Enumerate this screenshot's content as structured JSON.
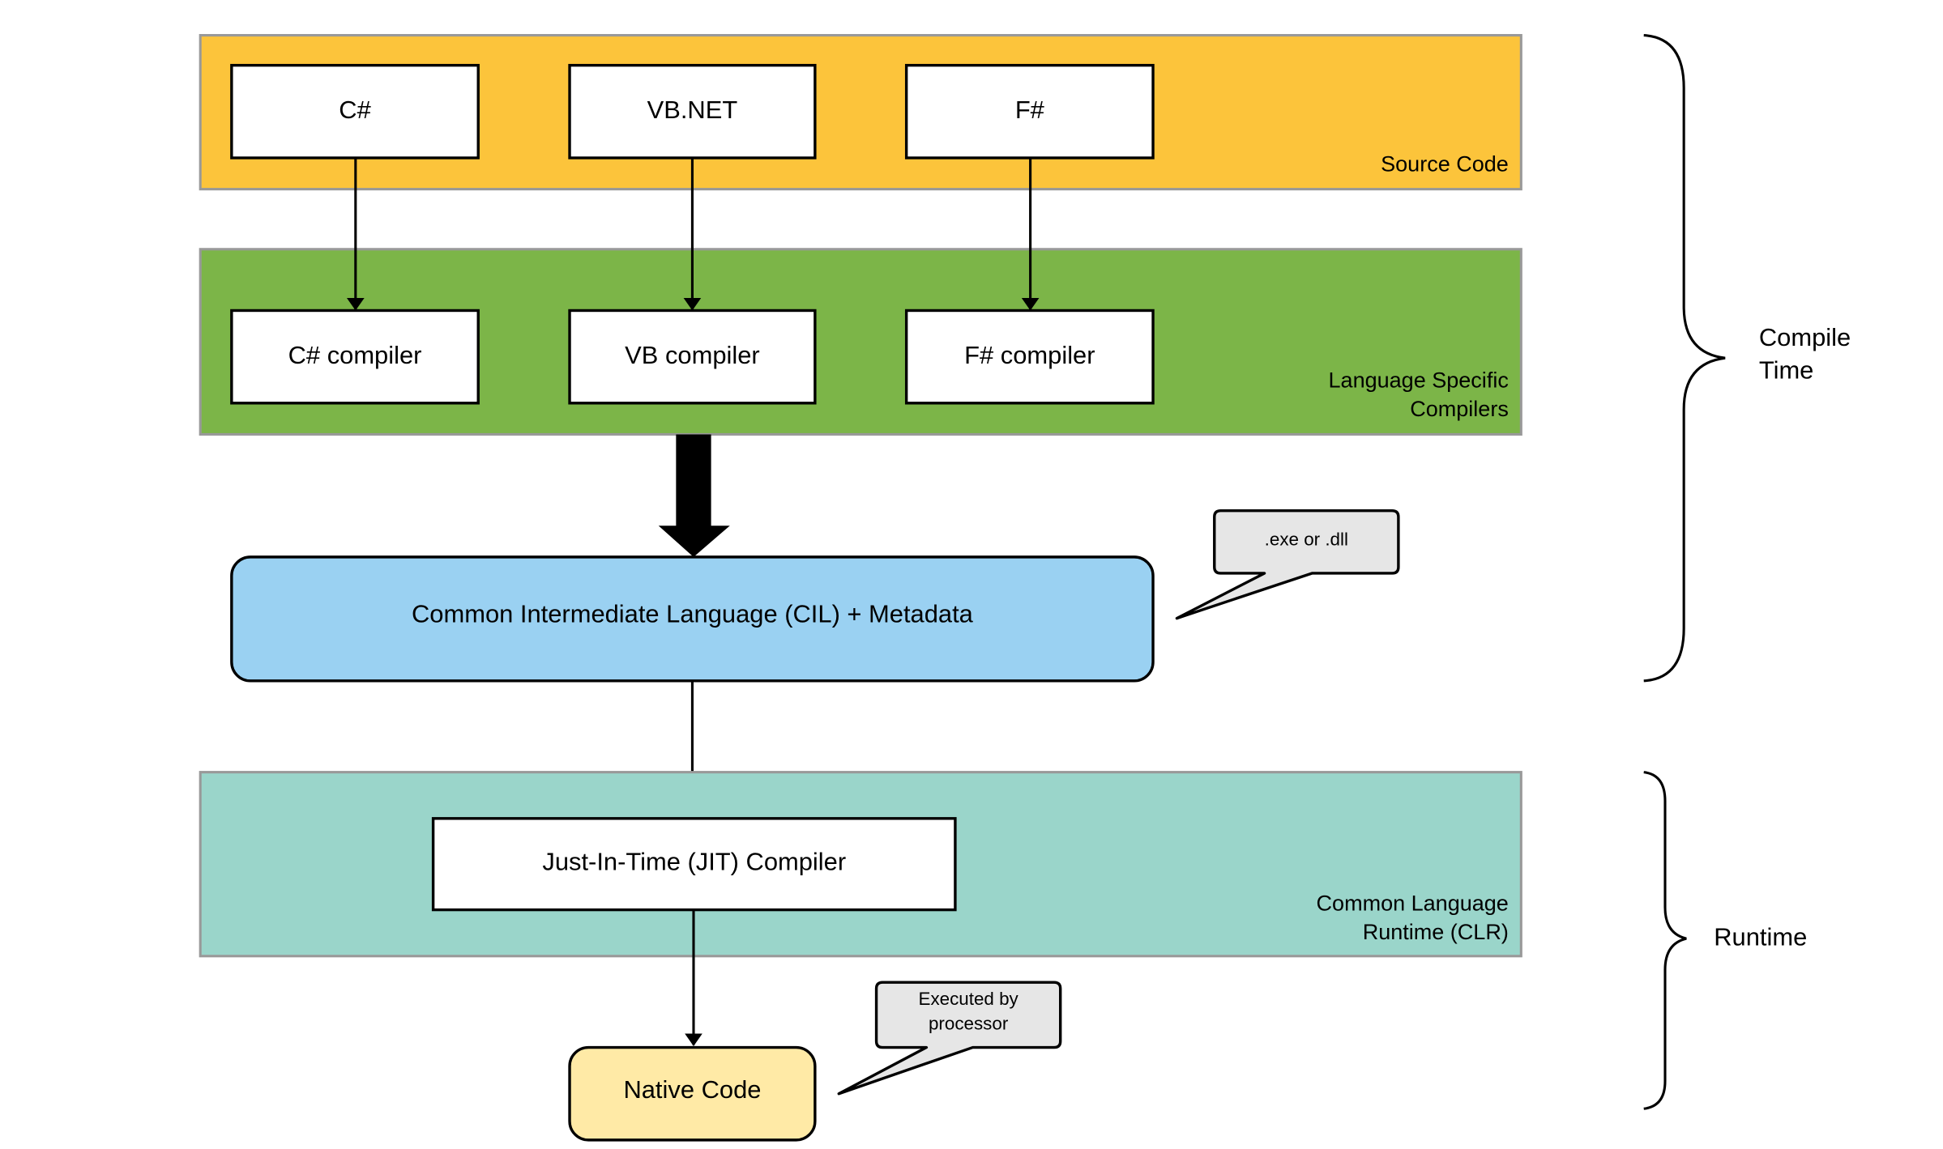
{
  "colors": {
    "source_band": "#FCC43B",
    "compiler_band": "#7CB548",
    "cil": "#9AD1F2",
    "clr_band": "#9AD5CA",
    "native": "#FFEAA6",
    "callout": "#E6E6E6",
    "band_border": "#999999"
  },
  "source_code": {
    "label": "Source Code",
    "languages": [
      "C#",
      "VB.NET",
      "F#"
    ]
  },
  "compilers": {
    "label_line1": "Language Specific",
    "label_line2": "Compilers",
    "items": [
      "C# compiler",
      "VB compiler",
      "F# compiler"
    ]
  },
  "cil": {
    "label": "Common Intermediate Language (CIL) + Metadata",
    "callout": ".exe or .dll"
  },
  "clr": {
    "label_line1": "Common Language",
    "label_line2": "Runtime (CLR)",
    "jit": "Just-In-Time (JIT) Compiler"
  },
  "native": {
    "label": "Native Code",
    "callout_line1": "Executed by",
    "callout_line2": "processor"
  },
  "phases": {
    "compile_line1": "Compile",
    "compile_line2": "Time",
    "runtime": "Runtime"
  }
}
